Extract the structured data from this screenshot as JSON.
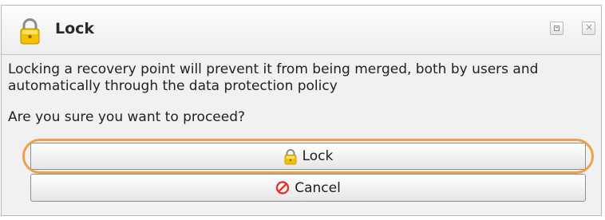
{
  "dialog": {
    "title": "Lock",
    "title_icon": "lock-icon",
    "message": "Locking a recovery point will prevent it from being merged, both by users and automatically through the data protection policy",
    "question": "Are you sure you want to proceed?",
    "buttons": {
      "lock": {
        "label": "Lock",
        "icon": "lock-icon"
      },
      "cancel": {
        "label": "Cancel",
        "icon": "cancel-icon"
      }
    },
    "highlight_color": "#f0a04a",
    "cancel_icon_color": "#e0332a",
    "lock_icon_color": "#f2c200"
  }
}
